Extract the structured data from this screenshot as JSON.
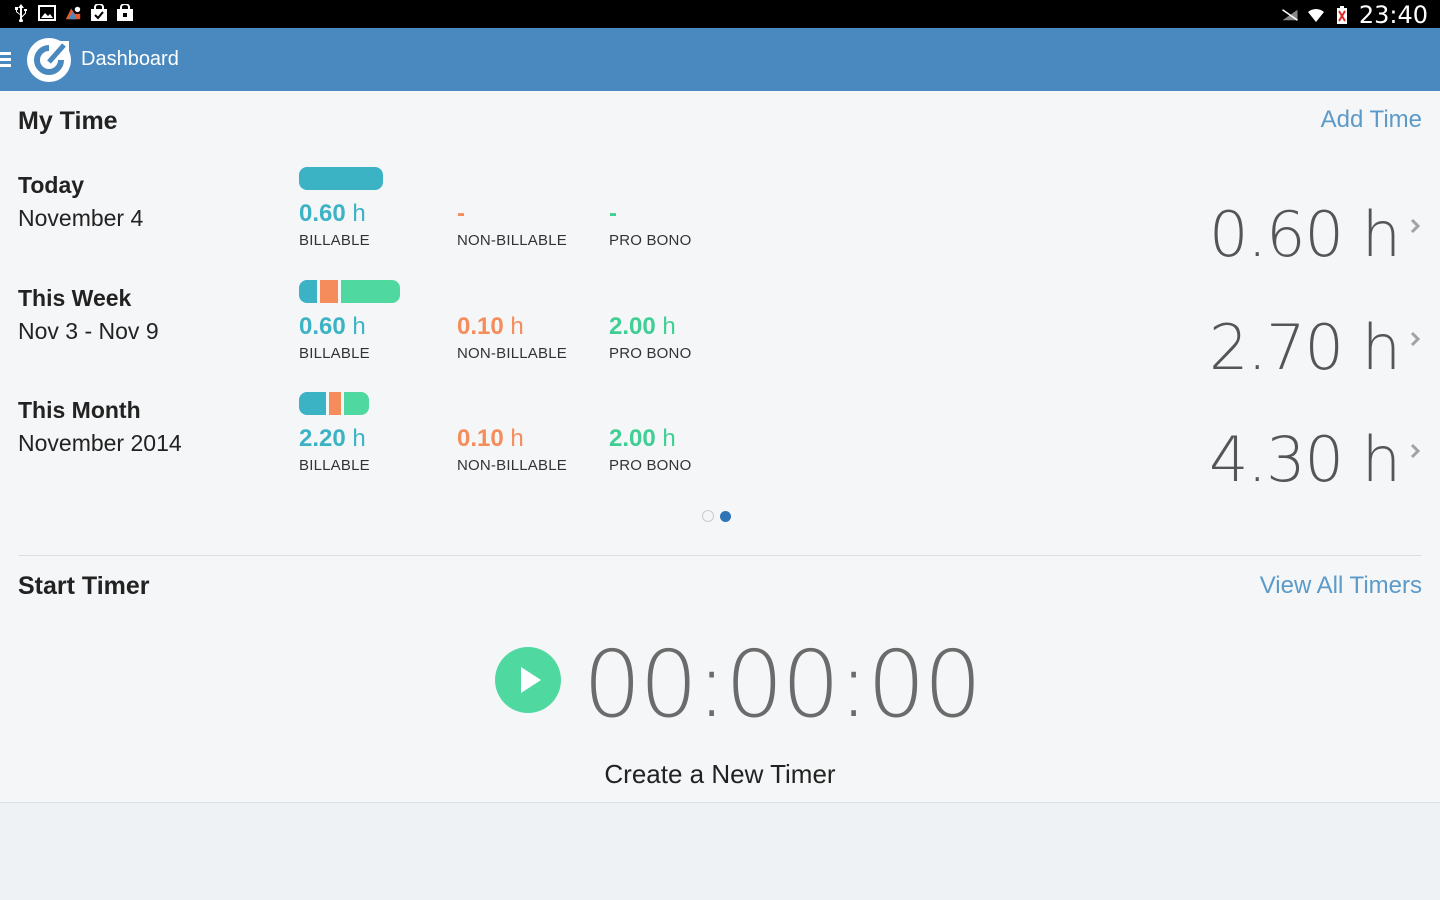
{
  "status_bar": {
    "left_icons": [
      "usb-icon",
      "image-icon",
      "recycle-icon",
      "shopping-bag-check-icon",
      "shopping-bag-icon"
    ],
    "right_icons": [
      "no-signal-icon",
      "wifi-icon",
      "battery-alert-icon"
    ],
    "time": "23:40"
  },
  "action_bar": {
    "title": "Dashboard",
    "icons": [
      "menu-icon",
      "app-logo-icon"
    ],
    "background": "#4a89bf"
  },
  "my_time": {
    "title": "My Time",
    "add_link": "Add Time",
    "rows": [
      {
        "title": "Today",
        "subtitle": "November 4",
        "billable_value": "0.60",
        "billable_unit": "h",
        "billable_label": "BILLABLE",
        "nonbillable_value": "-",
        "nonbillable_unit": "",
        "nonbillable_label": "NON-BILLABLE",
        "probono_value": "-",
        "probono_unit": "",
        "probono_label": "PRO BONO",
        "total": "0.60 h",
        "bar_share": [
          1.0,
          0,
          0
        ]
      },
      {
        "title": "This Week",
        "subtitle": "Nov 3 - Nov 9",
        "billable_value": "0.60",
        "billable_unit": "h",
        "billable_label": "BILLABLE",
        "nonbillable_value": "0.10",
        "nonbillable_unit": "h",
        "nonbillable_label": "NON-BILLABLE",
        "probono_value": "2.00",
        "probono_unit": "h",
        "probono_label": "PRO BONO",
        "total": "2.70 h",
        "bar_share": [
          0.222,
          0.037,
          0.741
        ]
      },
      {
        "title": "This Month",
        "subtitle": "November 2014",
        "billable_value": "2.20",
        "billable_unit": "h",
        "billable_label": "BILLABLE",
        "nonbillable_value": "0.10",
        "nonbillable_unit": "h",
        "nonbillable_label": "NON-BILLABLE",
        "probono_value": "2.00",
        "probono_unit": "h",
        "probono_label": "PRO BONO",
        "total": "4.30 h",
        "bar_share": [
          0.512,
          0.023,
          0.465
        ]
      }
    ],
    "pager": {
      "pages": 2,
      "active": 2
    }
  },
  "start_timer": {
    "title": "Start Timer",
    "view_all_link": "View All Timers",
    "timer_value": "00:00:00",
    "create_label": "Create a New Timer",
    "play_icon": "play-icon"
  },
  "colors": {
    "billable": "#3cb3c5",
    "nonbillable": "#f58c5b",
    "probono": "#4fd9a0",
    "link": "#5b9ac9"
  }
}
